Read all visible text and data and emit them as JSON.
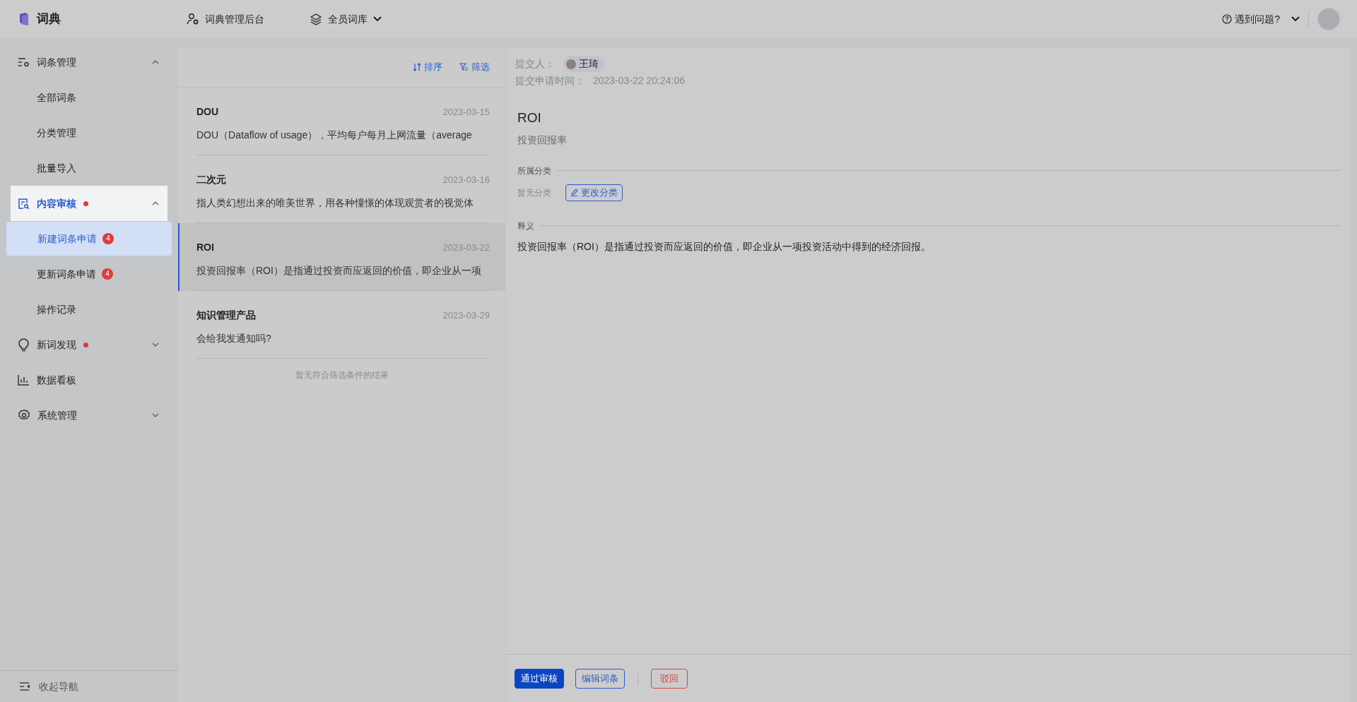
{
  "topbar": {
    "logo": "词典",
    "nav": [
      {
        "label": "词典管理后台",
        "kind": "admin"
      },
      {
        "label": "全员词库",
        "kind": "library"
      }
    ],
    "help": "遇到问题?"
  },
  "sidebar": {
    "items": [
      {
        "label": "词条管理",
        "kind": "entries",
        "expanded": true,
        "selected": false,
        "children": [
          {
            "label": "全部词条",
            "selected": false
          },
          {
            "label": "分类管理",
            "selected": false
          },
          {
            "label": "批量导入",
            "selected": false
          }
        ]
      },
      {
        "label": "内容审核",
        "kind": "review",
        "expanded": true,
        "selected": true,
        "dot": true,
        "children": [
          {
            "label": "新建词条申请",
            "selected": true,
            "badge": "4"
          },
          {
            "label": "更新词条申请",
            "selected": false,
            "badge": "4"
          },
          {
            "label": "操作记录",
            "selected": false
          }
        ]
      },
      {
        "label": "新词发现",
        "kind": "discover",
        "expanded": false,
        "selected": false,
        "dot": true
      },
      {
        "label": "数据看板",
        "kind": "dashboard",
        "selected": false
      },
      {
        "label": "系统管理",
        "kind": "system",
        "expanded": false,
        "selected": false
      }
    ],
    "collapse": "收起导航"
  },
  "list": {
    "sort": "排序",
    "filter": "筛选",
    "entries": [
      {
        "title": "DOU",
        "date": "2023-03-15",
        "summary": "DOU（Dataflow of usage），平均每户每月上网流量（average",
        "selected": false
      },
      {
        "title": "二次元",
        "date": "2023-03-16",
        "summary": "指人类幻想出来的唯美世界，用各种憧憬的体现观赏者的视觉体",
        "selected": false
      },
      {
        "title": "ROI",
        "date": "2023-03-22",
        "summary": "投资回报率（ROI）是指通过投资而应返回的价值，即企业从一项",
        "selected": true
      },
      {
        "title": "知识管理产品",
        "date": "2023-03-29",
        "summary": "会给我发通知吗?",
        "selected": false
      }
    ],
    "empty_text": "暂无符合筛选条件的结果"
  },
  "detail": {
    "submitter_label": "提交人：",
    "submitter": "王琦",
    "time_label": "提交申请时间：",
    "time": "2023-03-22 20:24:06",
    "term": "ROI",
    "translation": "投资回报率",
    "category_heading": "所属分类",
    "category": "暂无分类",
    "change_category": "更改分类",
    "definition_heading": "释义",
    "definition": "投资回报率（ROI）是指通过投资而应返回的价值，即企业从一项投资活动中得到的经济回报。",
    "actions": [
      {
        "label": "通过审核",
        "kind": "primary"
      },
      {
        "label": "编辑词条",
        "kind": "outline"
      },
      {
        "label": "驳回",
        "kind": "danger"
      }
    ]
  }
}
